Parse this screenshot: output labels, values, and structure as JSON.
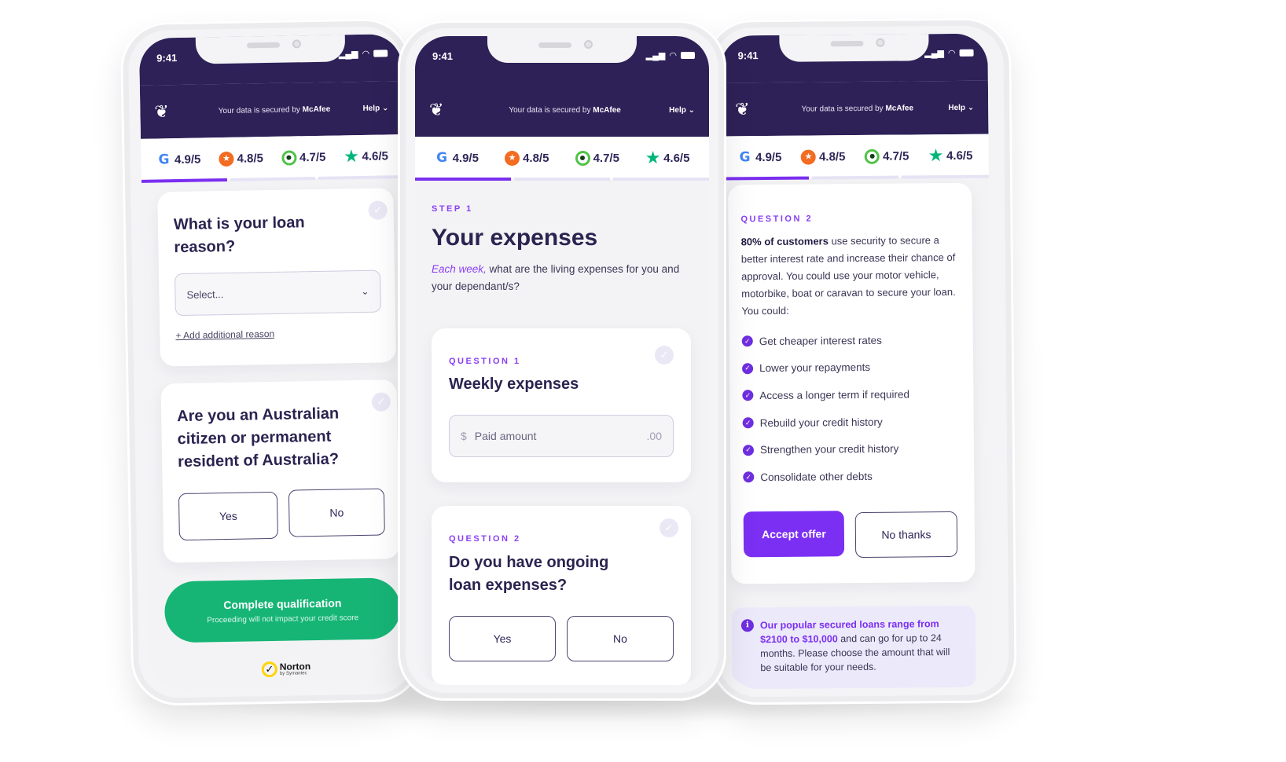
{
  "common": {
    "status_time": "9:41",
    "secured_prefix": "Your data is secured by",
    "secured_brand": "McAfee",
    "help_label": "Help",
    "ratings": [
      {
        "source": "google",
        "icon": "google-icon",
        "value": "4.9/5"
      },
      {
        "source": "productreview",
        "icon": "productreview-icon",
        "value": "4.8/5"
      },
      {
        "source": "reviews",
        "icon": "review-bubble-icon",
        "value": "4.7/5"
      },
      {
        "source": "trustpilot",
        "icon": "trustpilot-star-icon",
        "value": "4.6/5"
      }
    ],
    "progress_fraction": 0.33
  },
  "phone_left": {
    "q1_title": "What is your loan reason?",
    "select_placeholder": "Select...",
    "add_reason_link": "+ Add additional reason",
    "q2_title": "Are you an Australian citizen or permanent resident of Australia?",
    "yes_label": "Yes",
    "no_label": "No",
    "cta_label": "Complete qualification",
    "cta_sub": "Proceeding will not impact your credit score",
    "norton_brand": "Norton",
    "norton_sub": "by Symantec"
  },
  "phone_middle": {
    "step_label": "STEP 1",
    "title": "Your expenses",
    "intro_em": "Each week,",
    "intro_rest": " what are the living expenses for you and your dependant/s?",
    "q1_eyebrow": "QUESTION 1",
    "q1_title": "Weekly expenses",
    "amount_prefix": "$",
    "amount_placeholder": "Paid amount",
    "amount_suffix": ".00",
    "q2_eyebrow": "QUESTION 2",
    "q2_title": "Do you have ongoing loan expenses?",
    "yes_label": "Yes",
    "no_label": "No"
  },
  "phone_right": {
    "eyebrow": "QUESTION 2",
    "lead_bold": "80% of customers",
    "lead_rest": " use security to secure a better interest rate and increase their chance of approval. You could use your motor vehicle, motorbike, boat or caravan to secure your loan. You could:",
    "benefits": [
      "Get cheaper interest rates",
      "Lower your repayments",
      "Access a longer term if required",
      "Rebuild your credit history",
      "Strengthen your credit history",
      "Consolidate other debts"
    ],
    "accept_label": "Accept offer",
    "decline_label": "No thanks",
    "info_highlight_1": "Our popular secured loans range from $2100 to $10,000",
    "info_rest": " and can go for up to 24 months. Please choose the amount that will be suitable for your needs."
  },
  "colors": {
    "header_bg": "#2e2158",
    "accent_purple": "#7b2ff2",
    "cta_green": "#16b576",
    "info_bg": "#ece9fb"
  }
}
